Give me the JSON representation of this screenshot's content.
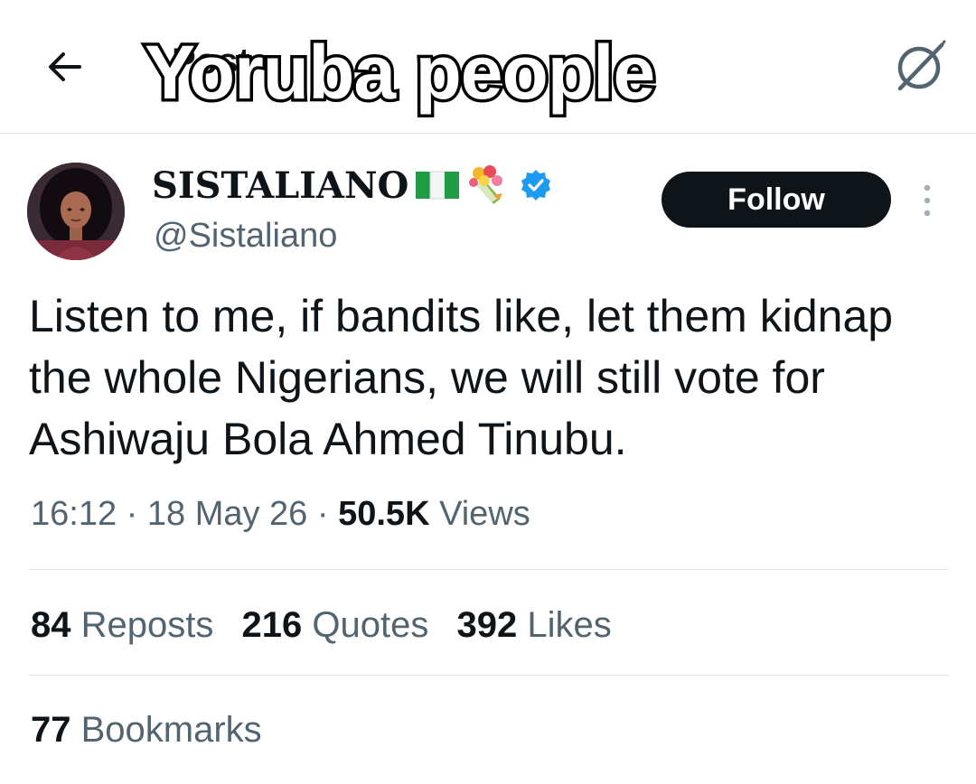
{
  "header": {
    "title": "Post",
    "overlay_caption": "Yoruba people",
    "back_icon": "arrow-left-icon",
    "grok_icon": "grok-icon"
  },
  "author": {
    "display_name": "SISTALIANO",
    "emojis": [
      "nigeria-flag-emoji",
      "bouquet-emoji"
    ],
    "verified_icon": "verified-badge-icon",
    "verified_color": "#1d9bf0",
    "handle": "@Sistaliano",
    "follow_label": "Follow"
  },
  "tweet": {
    "text": "Listen to me, if bandits like, let them kidnap the whole Nigerians, we will still vote for Ashiwaju Bola Ahmed Tinubu."
  },
  "meta": {
    "time": "16:12",
    "separator": "·",
    "date": "18 May 26",
    "views_count": "50.5K",
    "views_label": "Views"
  },
  "stats": {
    "reposts": {
      "count": "84",
      "label": "Reposts"
    },
    "quotes": {
      "count": "216",
      "label": "Quotes"
    },
    "likes": {
      "count": "392",
      "label": "Likes"
    },
    "bookmarks": {
      "count": "77",
      "label": "Bookmarks"
    }
  },
  "colors": {
    "text_primary": "#0f1419",
    "text_secondary": "#536471",
    "divider": "#e1e6ea",
    "follow_bg": "#0f1419"
  }
}
